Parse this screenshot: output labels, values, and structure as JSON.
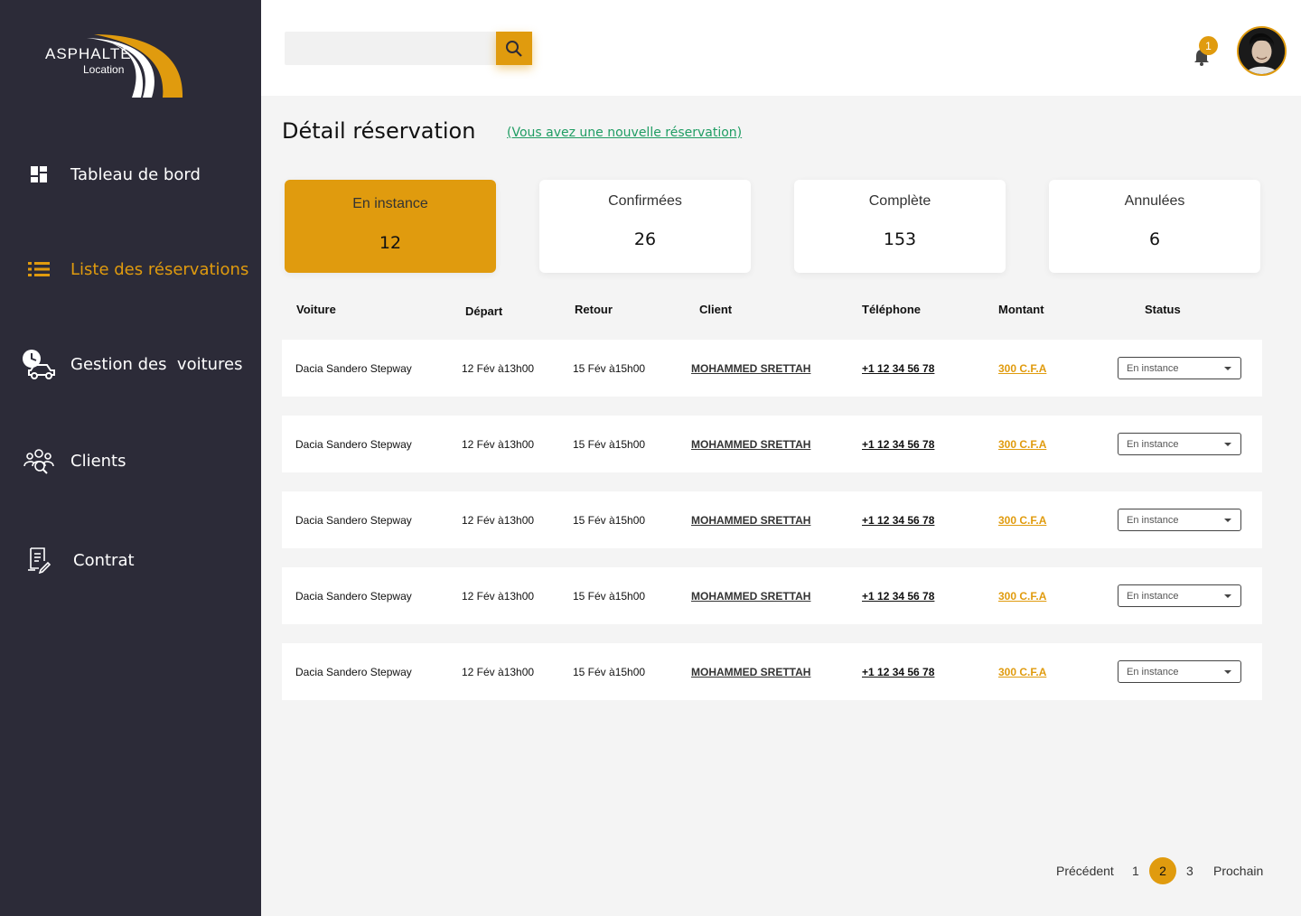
{
  "brand": {
    "name": "ASPHALTE",
    "sub": "Location"
  },
  "colors": {
    "accent": "#e09b0e",
    "sidebar": "#2c2b38",
    "link_green": "#1f9d63"
  },
  "sidebar": {
    "items": [
      {
        "label": "Tableau de bord",
        "icon": "dashboard-icon",
        "active": false
      },
      {
        "label": "Liste des réservations",
        "icon": "list-icon",
        "active": true
      },
      {
        "label": "Gestion des  voitures",
        "icon": "car-clock-icon",
        "active": false
      },
      {
        "label": "Clients",
        "icon": "clients-icon",
        "active": false
      },
      {
        "label": "Contrat",
        "icon": "contract-icon",
        "active": false
      }
    ]
  },
  "header": {
    "search_value": "",
    "notifications_count": "1"
  },
  "main": {
    "title": "Détail réservation",
    "new_reservation_link": "(Vous avez une nouvelle réservation)",
    "cards": [
      {
        "label": "En instance",
        "value": "12"
      },
      {
        "label": "Confirmées",
        "value": "26"
      },
      {
        "label": "Complète",
        "value": "153"
      },
      {
        "label": "Annulées",
        "value": "6"
      }
    ],
    "columns": [
      "Voiture",
      "Départ",
      "Retour",
      "Client",
      "Téléphone",
      "Montant",
      "Status"
    ],
    "rows": [
      {
        "car": "Dacia Sandero Stepway",
        "depart": "12 Fév à13h00",
        "retour": "15 Fév à15h00",
        "client": "MOHAMMED SRETTAH",
        "phone": "+1 12 34 56 78",
        "amount": "300 C.F.A",
        "status": "En instance"
      },
      {
        "car": "Dacia Sandero Stepway",
        "depart": "12 Fév à13h00",
        "retour": "15 Fév à15h00",
        "client": "MOHAMMED SRETTAH",
        "phone": "+1 12 34 56 78",
        "amount": "300 C.F.A",
        "status": "En instance"
      },
      {
        "car": "Dacia Sandero Stepway",
        "depart": "12 Fév à13h00",
        "retour": "15 Fév à15h00",
        "client": "MOHAMMED SRETTAH",
        "phone": "+1 12 34 56 78",
        "amount": "300 C.F.A",
        "status": "En instance"
      },
      {
        "car": "Dacia Sandero Stepway",
        "depart": "12 Fév à13h00",
        "retour": "15 Fév à15h00",
        "client": "MOHAMMED SRETTAH",
        "phone": "+1 12 34 56 78",
        "amount": "300 C.F.A",
        "status": "En instance"
      },
      {
        "car": "Dacia Sandero Stepway",
        "depart": "12 Fév à13h00",
        "retour": "15 Fév à15h00",
        "client": "MOHAMMED SRETTAH",
        "phone": "+1 12 34 56 78",
        "amount": "300 C.F.A",
        "status": "En instance"
      }
    ]
  },
  "pagination": {
    "prev": "Précédent",
    "pages": [
      "1",
      "2",
      "3"
    ],
    "current": "2",
    "next": "Prochain"
  }
}
